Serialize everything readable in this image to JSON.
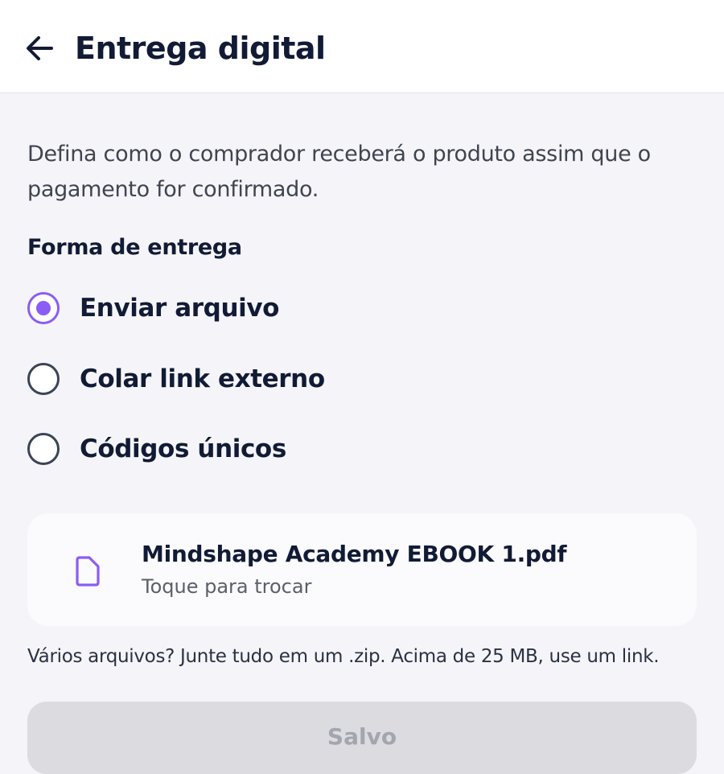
{
  "header": {
    "back_icon": "arrow-left-icon",
    "title": "Entrega digital"
  },
  "description": "Defina como o comprador receberá o produto assim que o pagamento for confirmado.",
  "delivery": {
    "label": "Forma de entrega",
    "options": [
      {
        "label": "Enviar arquivo",
        "selected": true
      },
      {
        "label": "Colar link externo",
        "selected": false
      },
      {
        "label": "Códigos únicos",
        "selected": false
      }
    ]
  },
  "file": {
    "icon": "file-icon",
    "name": "Mindshape Academy EBOOK 1.pdf",
    "hint": "Toque para trocar"
  },
  "help_text": "Vários arquivos? Junte tudo em um .zip. Acima de 25 MB, use um link.",
  "save_button": {
    "label": "Salvo",
    "disabled": true
  },
  "colors": {
    "accent": "#8b5cf6",
    "text_primary": "#111b35",
    "background": "#f5f5f9",
    "button_disabled": "#dcdce0"
  }
}
